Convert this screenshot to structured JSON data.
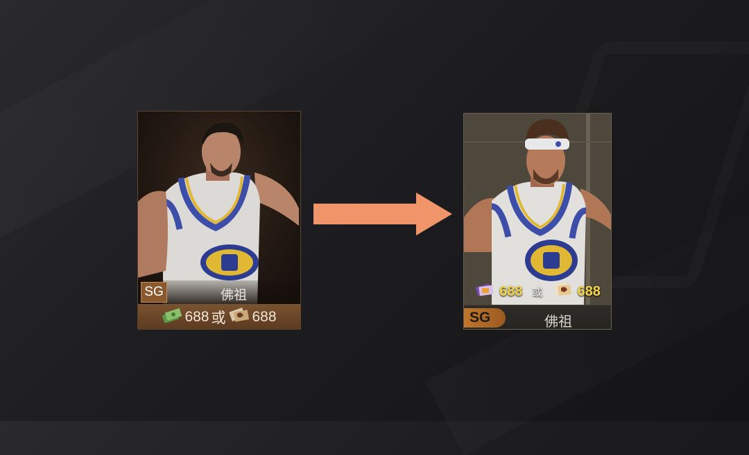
{
  "old_card": {
    "position": "SG",
    "name": "佛祖",
    "price_a": "688",
    "separator": "或",
    "price_b": "688",
    "currency_a_icon": "cash-icon",
    "currency_b_icon": "ticket-icon"
  },
  "new_card": {
    "position": "SG",
    "name": "佛祖",
    "price_a": "688",
    "separator": "或",
    "price_b": "688",
    "currency_a_icon": "card-pack-icon",
    "currency_b_icon": "ticket-icon"
  },
  "arrow_color": "#f0956a"
}
